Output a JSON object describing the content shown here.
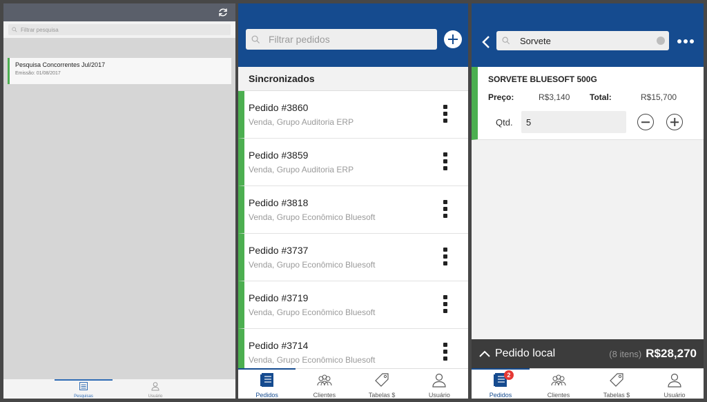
{
  "panel1": {
    "search_placeholder": "Filtrar pesquisa",
    "item": {
      "title": "Pesquisa Concorrentes Jul/2017",
      "subtitle": "Emissão: 01/08/2017"
    },
    "tabs": [
      {
        "label": "Pesquisas",
        "icon": "list-icon"
      },
      {
        "label": "Usuário",
        "icon": "user-icon"
      }
    ]
  },
  "panel2": {
    "search_placeholder": "Filtrar pedidos",
    "section_title": "Sincronizados",
    "orders": [
      {
        "title": "Pedido #3860",
        "subtitle": "Venda, Grupo Auditoria ERP"
      },
      {
        "title": "Pedido #3859",
        "subtitle": "Venda, Grupo Auditoria ERP"
      },
      {
        "title": "Pedido #3818",
        "subtitle": "Venda, Grupo Econômico Bluesoft"
      },
      {
        "title": "Pedido #3737",
        "subtitle": "Venda, Grupo Econômico Bluesoft"
      },
      {
        "title": "Pedido #3719",
        "subtitle": "Venda, Grupo Econômico Bluesoft"
      },
      {
        "title": "Pedido #3714",
        "subtitle": "Venda, Grupo Econômico Bluesoft"
      }
    ],
    "tabs": [
      {
        "label": "Pedidos"
      },
      {
        "label": "Clientes"
      },
      {
        "label": "Tabelas $"
      },
      {
        "label": "Usuário"
      }
    ]
  },
  "panel3": {
    "search_value": "Sorvete",
    "product": {
      "name": "SORVETE BLUESOFT 500G",
      "price_label": "Preço:",
      "price": "R$3,140",
      "total_label": "Total:",
      "total": "R$15,700",
      "qty_label": "Qtd.",
      "qty": "5"
    },
    "footer": {
      "label": "Pedido local",
      "count": "(8 itens)",
      "total": "R$28,270"
    },
    "badge": "2",
    "tabs": [
      {
        "label": "Pedidos"
      },
      {
        "label": "Clientes"
      },
      {
        "label": "Tabelas $"
      },
      {
        "label": "Usuário"
      }
    ]
  },
  "colors": {
    "brand_blue": "#154b8f",
    "accent_green": "#4caf50",
    "badge_red": "#e53935"
  }
}
